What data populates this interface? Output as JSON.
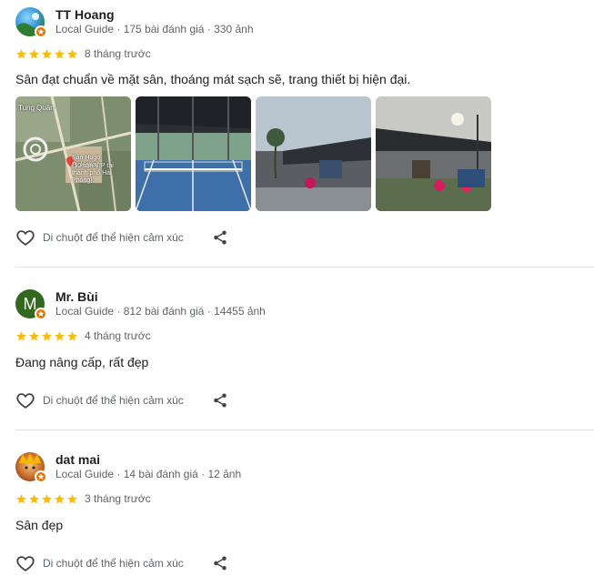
{
  "colors": {
    "star": "#fbbc04",
    "badge": "#e37400",
    "meta": "#5f6368"
  },
  "reviews": [
    {
      "name": "TT Hoang",
      "meta": "Local Guide · 175 bài đánh giá · 330 ảnh",
      "rating": 5,
      "when": "8 tháng trước",
      "text": "Sân đạt chuẩn về mặt sân, thoáng mát sạch sẽ, trang thiết bị hiện đại.",
      "map_label_1": "Tung Quân",
      "map_label_2": "Sân Hugo Pickleball",
      "map_label_3": "(10 sân VIP tại thành phố Hải Phòng)",
      "reaction_label": "Di chuột để thể hiện cảm xúc"
    },
    {
      "name": "Mr. Bùi",
      "avatar_letter": "M",
      "meta": "Local Guide · 812 bài đánh giá · 14455 ảnh",
      "rating": 5,
      "when": "4 tháng trước",
      "text": "Đang nâng cấp, rất đẹp",
      "reaction_label": "Di chuột để thể hiện cảm xúc"
    },
    {
      "name": "dat mai",
      "meta": "Local Guide · 14 bài đánh giá · 12 ảnh",
      "rating": 5,
      "when": "3 tháng trước",
      "text": "Sân đẹp",
      "reaction_label": "Di chuột để thể hiện cảm xúc"
    }
  ]
}
